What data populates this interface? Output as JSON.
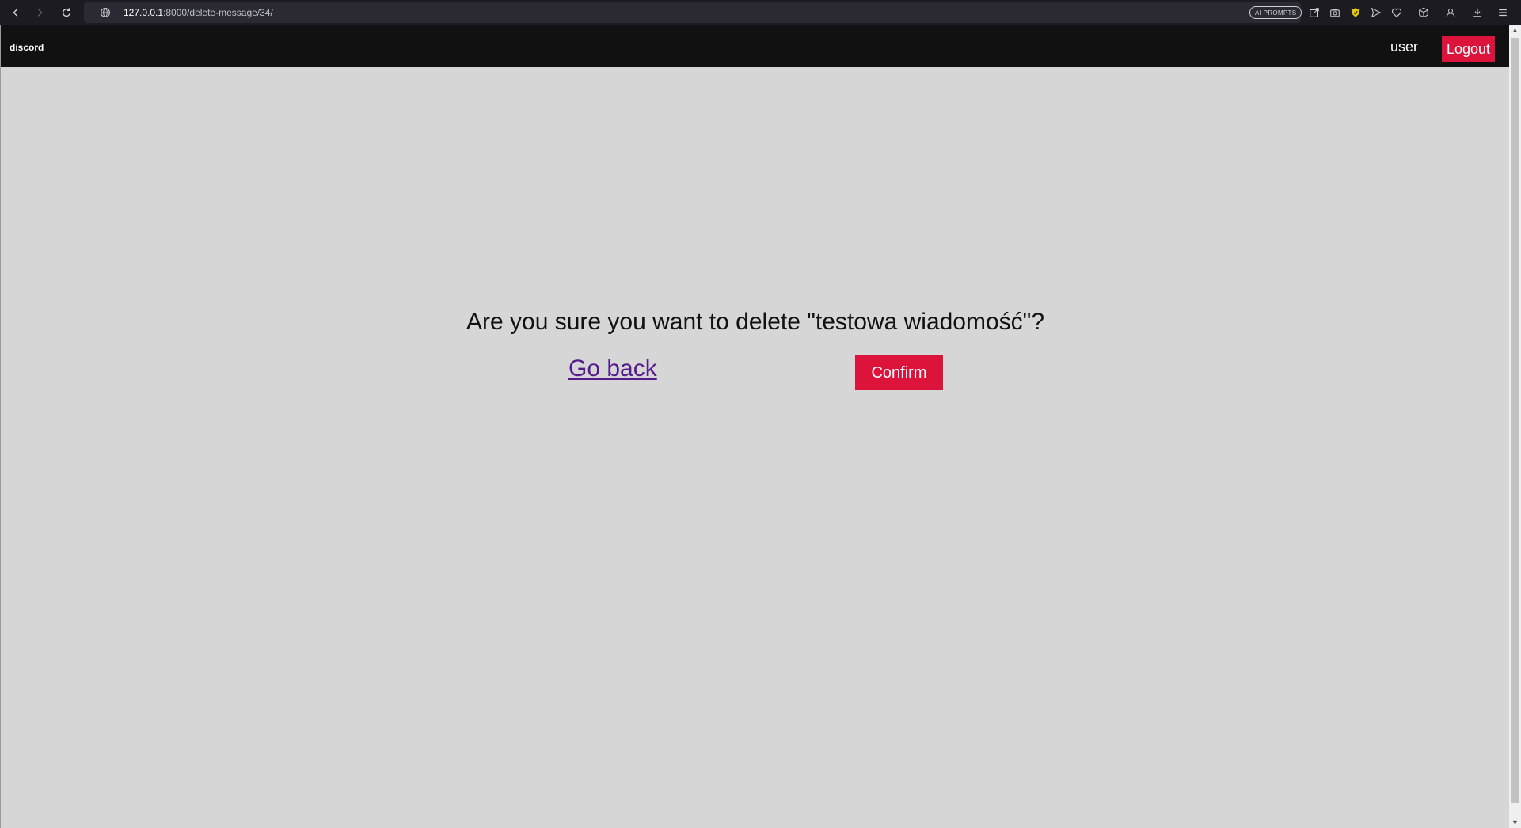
{
  "browser": {
    "url_host": "127.0.0.1",
    "url_path": ":8000/delete-message/34/",
    "ai_prompts_label": "AI PROMPTS",
    "icons": [
      "back-icon",
      "forward-icon",
      "reload-icon",
      "globe-icon",
      "share-icon",
      "screenshot-icon",
      "shield-icon",
      "send-icon",
      "heart-icon",
      "cube-icon",
      "account-icon",
      "download-icon",
      "menu-icon"
    ]
  },
  "header": {
    "brand": "discord",
    "username": "user",
    "logout_label": "Logout"
  },
  "main": {
    "question": "Are you sure you want to delete \"testowa wiadomość\"?",
    "go_back_label": "Go back",
    "confirm_label": "Confirm"
  },
  "colors": {
    "accent": "#dc143c",
    "header_bg": "#111111",
    "page_bg": "#d6d6d6",
    "link_visited": "#551a8b"
  }
}
